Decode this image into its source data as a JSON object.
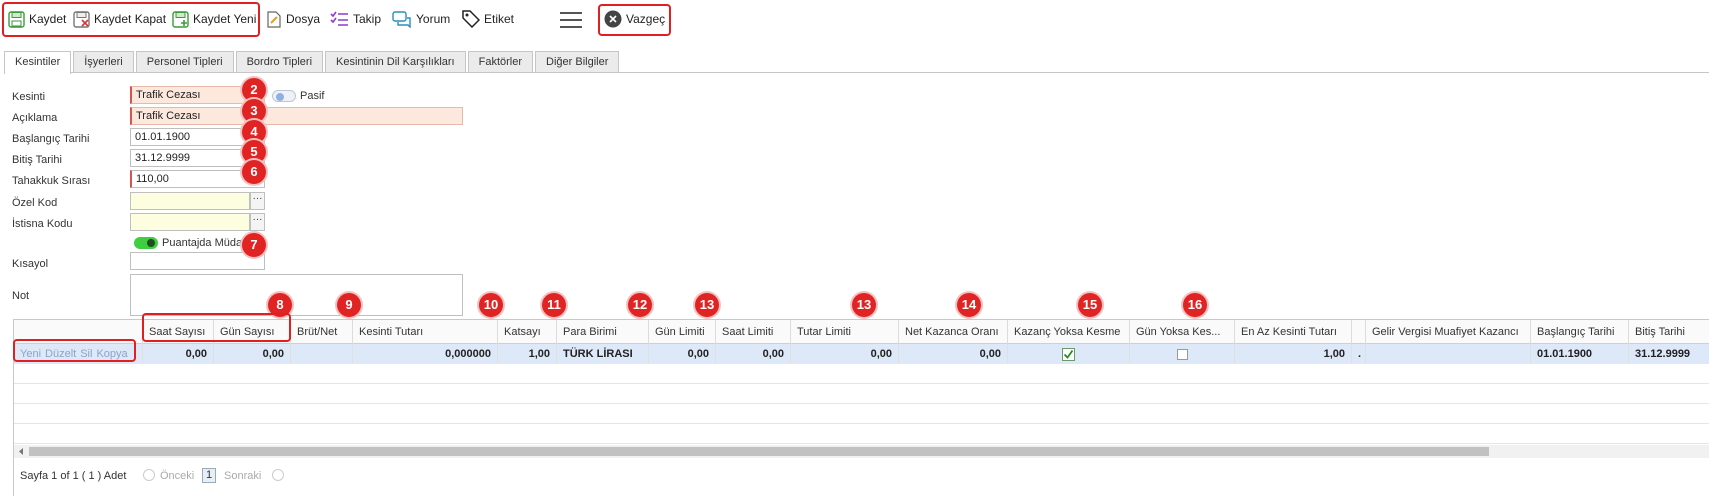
{
  "toolbar": {
    "kaydet": "Kaydet",
    "kaydet_kapat": "Kaydet Kapat",
    "kaydet_yeni": "Kaydet Yeni",
    "dosya": "Dosya",
    "takip": "Takip",
    "yorum": "Yorum",
    "etiket": "Etiket",
    "vazgec": "Vazgeç"
  },
  "tabs": [
    "Kesintiler",
    "İşyerleri",
    "Personel Tipleri",
    "Bordro Tipleri",
    "Kesintinin Dil Karşılıkları",
    "Faktörler",
    "Diğer Bilgiler"
  ],
  "form": {
    "kesinti_label": "Kesinti",
    "kesinti_value": "Trafik Cezası",
    "pasif_label": "Pasif",
    "aciklama_label": "Açıklama",
    "aciklama_value": "Trafik Cezası",
    "baslangic_label": "Başlangıç Tarihi",
    "baslangic_value": "01.01.1900",
    "bitis_label": "Bitiş Tarihi",
    "bitis_value": "31.12.9999",
    "tahakkuk_label": "Tahakkuk Sırası",
    "tahakkuk_value": "110,00",
    "ozel_kod_label": "Özel Kod",
    "istisna_label": "İstisna Kodu",
    "puantaj_label": "Puantajda Müdahale",
    "kisayol_label": "Kısayol",
    "not_label": "Not",
    "dots": "···"
  },
  "badges": [
    "2",
    "3",
    "4",
    "5",
    "6",
    "7",
    "8",
    "9",
    "10",
    "11",
    "12",
    "13",
    "13",
    "14",
    "15",
    "16"
  ],
  "grid": {
    "headers": [
      "",
      "Saat Sayısı",
      "Gün Sayısı",
      "Brüt/Net",
      "Kesinti Tutarı",
      "Katsayı",
      "Para Birimi",
      "Gün Limiti",
      "Saat Limiti",
      "Tutar Limiti",
      "Net Kazanca Oranı",
      "Kazanç Yoksa Kesme",
      "Gün Yoksa Kes...",
      "En Az Kesinti Tutarı",
      "",
      "Gelir Vergisi Muafiyet Kazancı",
      "Başlangıç Tarihi",
      "Bitiş Tarihi"
    ],
    "row_links": [
      "Yeni",
      "Düzelt",
      "Sil",
      "Kopya"
    ],
    "row": {
      "saat_sayisi": "0,00",
      "gun_sayisi": "0,00",
      "brut_net": "",
      "kesinti_tutari": "0,000000",
      "katsayi": "1,00",
      "para_birimi": "TÜRK LİRASI",
      "gun_limiti": "0,00",
      "saat_limiti": "0,00",
      "tutar_limiti": "0,00",
      "net_kazanca_orani": "0,00",
      "kazanc_yoksa_kesme": true,
      "gun_yoksa_kesme": false,
      "en_az_kesinti": "1,00",
      "dot": ".",
      "gelir_vergisi": "",
      "baslangic": "01.01.1900",
      "bitis": "31.12.9999"
    }
  },
  "pager": {
    "info": "Sayfa 1 of 1 ( 1 ) Adet",
    "prev": "Önceki",
    "page": "1",
    "next": "Sonraki"
  },
  "colors": {
    "highlight": "#e02020",
    "badge": "#e02424",
    "toggle_on": "#3fce3f",
    "required_bg": "#fde8dd",
    "optional_bg": "#fdfde0",
    "selected_row": "#dde8f8"
  }
}
